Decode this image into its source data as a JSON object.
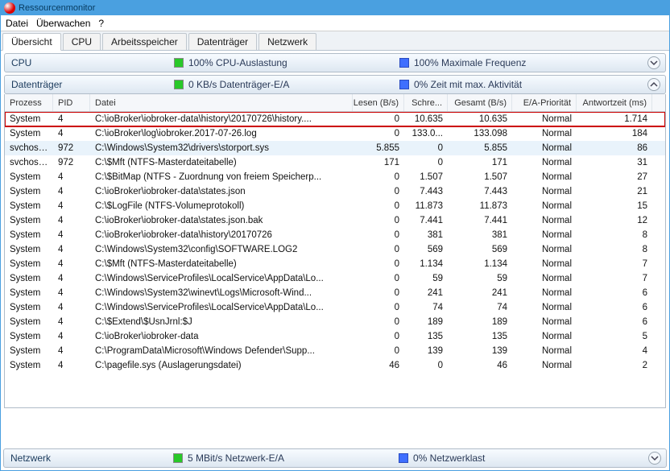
{
  "window": {
    "title": "Ressourcenmonitor"
  },
  "menu": {
    "file": "Datei",
    "monitor": "Überwachen",
    "help": "?"
  },
  "tabs": {
    "overview": "Übersicht",
    "cpu": "CPU",
    "memory": "Arbeitsspeicher",
    "disk": "Datenträger",
    "network": "Netzwerk"
  },
  "cpu_section": {
    "title": "CPU",
    "stat1": "100% CPU-Auslastung",
    "stat2": "100% Maximale Frequenz"
  },
  "disk_section": {
    "title": "Datenträger",
    "stat1": "0 KB/s Datenträger-E/A",
    "stat2": "0% Zeit mit max. Aktivität",
    "columns": {
      "process": "Prozess",
      "pid": "PID",
      "file": "Datei",
      "read": "Lesen (B/s)",
      "write": "Schre...",
      "total": "Gesamt (B/s)",
      "priority": "E/A-Priorität",
      "response": "Antwortzeit (ms)"
    },
    "rows": [
      {
        "proc": "System",
        "pid": "4",
        "file": "C:\\ioBroker\\iobroker-data\\history\\20170726\\history....",
        "read": "0",
        "write": "10.635",
        "total": "10.635",
        "prio": "Normal",
        "resp": "1.714",
        "hl": true
      },
      {
        "proc": "System",
        "pid": "4",
        "file": "C:\\ioBroker\\log\\iobroker.2017-07-26.log",
        "read": "0",
        "write": "133.0...",
        "total": "133.098",
        "prio": "Normal",
        "resp": "184"
      },
      {
        "proc": "svchost...",
        "pid": "972",
        "file": "C:\\Windows\\System32\\drivers\\storport.sys",
        "read": "5.855",
        "write": "0",
        "total": "5.855",
        "prio": "Normal",
        "resp": "86",
        "sel": true
      },
      {
        "proc": "svchost...",
        "pid": "972",
        "file": "C:\\$Mft (NTFS-Masterdateitabelle)",
        "read": "171",
        "write": "0",
        "total": "171",
        "prio": "Normal",
        "resp": "31"
      },
      {
        "proc": "System",
        "pid": "4",
        "file": "C:\\$BitMap (NTFS - Zuordnung von freiem Speicherp...",
        "read": "0",
        "write": "1.507",
        "total": "1.507",
        "prio": "Normal",
        "resp": "27"
      },
      {
        "proc": "System",
        "pid": "4",
        "file": "C:\\ioBroker\\iobroker-data\\states.json",
        "read": "0",
        "write": "7.443",
        "total": "7.443",
        "prio": "Normal",
        "resp": "21"
      },
      {
        "proc": "System",
        "pid": "4",
        "file": "C:\\$LogFile (NTFS-Volumeprotokoll)",
        "read": "0",
        "write": "11.873",
        "total": "11.873",
        "prio": "Normal",
        "resp": "15"
      },
      {
        "proc": "System",
        "pid": "4",
        "file": "C:\\ioBroker\\iobroker-data\\states.json.bak",
        "read": "0",
        "write": "7.441",
        "total": "7.441",
        "prio": "Normal",
        "resp": "12"
      },
      {
        "proc": "System",
        "pid": "4",
        "file": "C:\\ioBroker\\iobroker-data\\history\\20170726",
        "read": "0",
        "write": "381",
        "total": "381",
        "prio": "Normal",
        "resp": "8"
      },
      {
        "proc": "System",
        "pid": "4",
        "file": "C:\\Windows\\System32\\config\\SOFTWARE.LOG2",
        "read": "0",
        "write": "569",
        "total": "569",
        "prio": "Normal",
        "resp": "8"
      },
      {
        "proc": "System",
        "pid": "4",
        "file": "C:\\$Mft (NTFS-Masterdateitabelle)",
        "read": "0",
        "write": "1.134",
        "total": "1.134",
        "prio": "Normal",
        "resp": "7"
      },
      {
        "proc": "System",
        "pid": "4",
        "file": "C:\\Windows\\ServiceProfiles\\LocalService\\AppData\\Lo...",
        "read": "0",
        "write": "59",
        "total": "59",
        "prio": "Normal",
        "resp": "7"
      },
      {
        "proc": "System",
        "pid": "4",
        "file": "C:\\Windows\\System32\\winevt\\Logs\\Microsoft-Wind...",
        "read": "0",
        "write": "241",
        "total": "241",
        "prio": "Normal",
        "resp": "6"
      },
      {
        "proc": "System",
        "pid": "4",
        "file": "C:\\Windows\\ServiceProfiles\\LocalService\\AppData\\Lo...",
        "read": "0",
        "write": "74",
        "total": "74",
        "prio": "Normal",
        "resp": "6"
      },
      {
        "proc": "System",
        "pid": "4",
        "file": "C:\\$Extend\\$UsnJrnl:$J",
        "read": "0",
        "write": "189",
        "total": "189",
        "prio": "Normal",
        "resp": "6"
      },
      {
        "proc": "System",
        "pid": "4",
        "file": "C:\\ioBroker\\iobroker-data",
        "read": "0",
        "write": "135",
        "total": "135",
        "prio": "Normal",
        "resp": "5"
      },
      {
        "proc": "System",
        "pid": "4",
        "file": "C:\\ProgramData\\Microsoft\\Windows Defender\\Supp...",
        "read": "0",
        "write": "139",
        "total": "139",
        "prio": "Normal",
        "resp": "4"
      },
      {
        "proc": "System",
        "pid": "4",
        "file": "C:\\pagefile.sys (Auslagerungsdatei)",
        "read": "46",
        "write": "0",
        "total": "46",
        "prio": "Normal",
        "resp": "2"
      }
    ]
  },
  "net_section": {
    "title": "Netzwerk",
    "stat1": "5 MBit/s Netzwerk-E/A",
    "stat2": "0% Netzwerklast"
  }
}
